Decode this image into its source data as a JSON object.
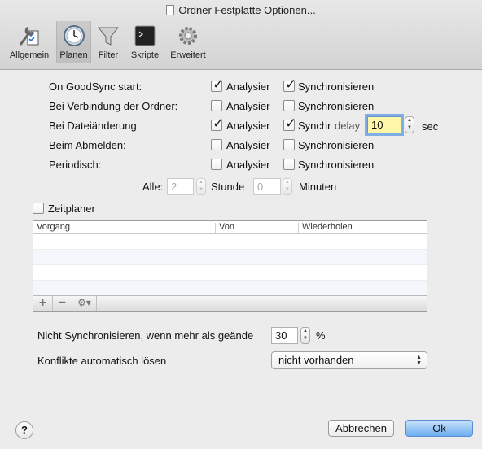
{
  "window": {
    "title": "Ordner Festplatte Optionen..."
  },
  "toolbar": {
    "items": [
      {
        "label": "Allgemein",
        "icon": "wrench-checklist-icon",
        "selected": false
      },
      {
        "label": "Planen",
        "icon": "clock-icon",
        "selected": true
      },
      {
        "label": "Filter",
        "icon": "funnel-icon",
        "selected": false
      },
      {
        "label": "Skripte",
        "icon": "terminal-icon",
        "selected": false
      },
      {
        "label": "Erweitert",
        "icon": "gear-icon",
        "selected": false
      }
    ]
  },
  "schedule": {
    "analyze_label": "Analysier",
    "sync_label": "Synchronisieren",
    "rows": [
      {
        "label": "On GoodSync start:",
        "analyze": true,
        "sync": true
      },
      {
        "label": "Bei Verbindung der Ordner:",
        "analyze": false,
        "sync": false
      },
      {
        "label": "Bei Dateiänderung:",
        "analyze": true,
        "sync": true
      },
      {
        "label": "Beim Abmelden:",
        "analyze": false,
        "sync": false
      },
      {
        "label": "Periodisch:",
        "analyze": false,
        "sync": false
      }
    ],
    "delay": {
      "overlap_text": "Synchr",
      "label": "delay",
      "value": "10",
      "unit": "sec"
    },
    "periodic": {
      "every_label": "Alle:",
      "hours_value": "2",
      "hours_label": "Stunde",
      "minutes_value": "0",
      "minutes_label": "Minuten"
    }
  },
  "scheduler": {
    "label": "Zeitplaner",
    "checked": false,
    "columns": [
      "Vorgang",
      "Von",
      "Wiederholen"
    ],
    "row_count": 5
  },
  "footer_opts": {
    "no_sync_label": "Nicht Synchronisieren, wenn mehr als geände",
    "no_sync_value": "30",
    "no_sync_unit": "%",
    "conflicts_label": "Konflikte automatisch lösen",
    "conflicts_value": "nicht vorhanden"
  },
  "buttons": {
    "help": "?",
    "cancel": "Abbrechen",
    "ok": "Ok"
  },
  "colors": {
    "accent": "#6eaef0",
    "focus_ring": "#7eaee6"
  }
}
